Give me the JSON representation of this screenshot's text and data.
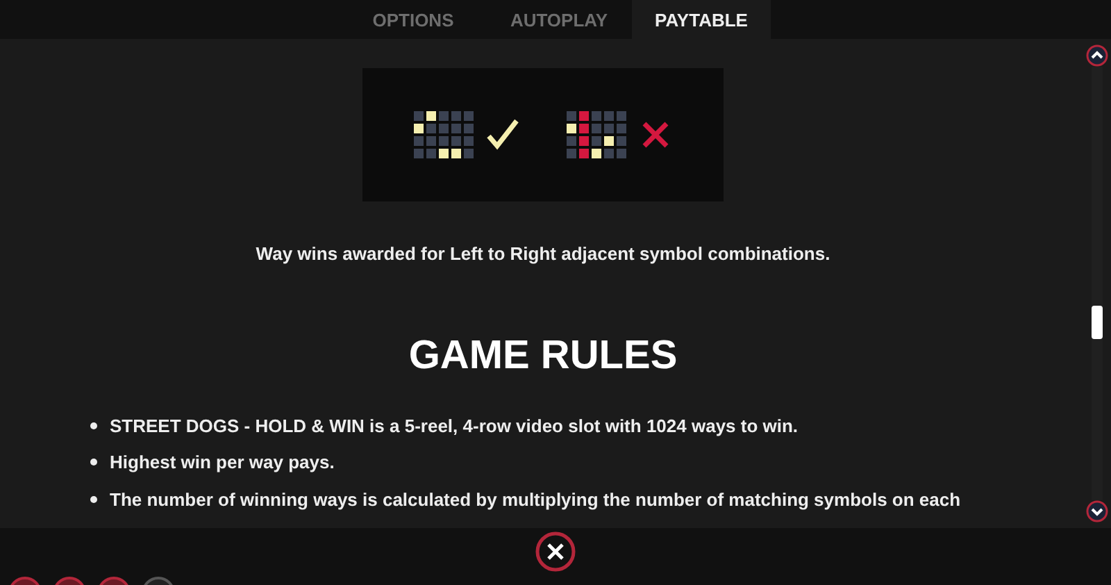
{
  "tabs": [
    {
      "label": "OPTIONS",
      "selected": false
    },
    {
      "label": "AUTOPLAY",
      "selected": false
    },
    {
      "label": "PAYTABLE",
      "selected": true
    }
  ],
  "examples": [
    {
      "valid": true,
      "rows": [
        {
          "cells": [
            {
              "color": "#3b4252"
            },
            {
              "color": "#f5efb0"
            },
            {
              "color": "#3b4252"
            },
            {
              "color": "#3b4252"
            },
            {
              "color": "#3b4252"
            }
          ]
        },
        {
          "cells": [
            {
              "color": "#f5efb0"
            },
            {
              "color": "#3b4252"
            },
            {
              "color": "#3b4252"
            },
            {
              "color": "#3b4252"
            },
            {
              "color": "#3b4252"
            }
          ]
        },
        {
          "cells": [
            {
              "color": "#3b4252"
            },
            {
              "color": "#3b4252"
            },
            {
              "color": "#3b4252"
            },
            {
              "color": "#3b4252"
            },
            {
              "color": "#3b4252"
            }
          ]
        },
        {
          "cells": [
            {
              "color": "#3b4252"
            },
            {
              "color": "#3b4252"
            },
            {
              "color": "#f5efb0"
            },
            {
              "color": "#f5efb0"
            },
            {
              "color": "#3b4252"
            }
          ]
        }
      ]
    },
    {
      "valid": false,
      "rows": [
        {
          "cells": [
            {
              "color": "#3b4252"
            },
            {
              "color": "#d4183f"
            },
            {
              "color": "#3b4252"
            },
            {
              "color": "#3b4252"
            },
            {
              "color": "#3b4252"
            }
          ]
        },
        {
          "cells": [
            {
              "color": "#f5efb0"
            },
            {
              "color": "#d4183f"
            },
            {
              "color": "#3b4252"
            },
            {
              "color": "#3b4252"
            },
            {
              "color": "#3b4252"
            }
          ]
        },
        {
          "cells": [
            {
              "color": "#3b4252"
            },
            {
              "color": "#d4183f"
            },
            {
              "color": "#3b4252"
            },
            {
              "color": "#f5efb0"
            },
            {
              "color": "#3b4252"
            }
          ]
        },
        {
          "cells": [
            {
              "color": "#3b4252"
            },
            {
              "color": "#d4183f"
            },
            {
              "color": "#f5efb0"
            },
            {
              "color": "#3b4252"
            },
            {
              "color": "#3b4252"
            }
          ]
        }
      ]
    }
  ],
  "caption": "Way wins awarded for Left to Right adjacent symbol combinations.",
  "heading": "GAME RULES",
  "rules": [
    "STREET DOGS - HOLD & WIN is a 5-reel, 4-row video slot with 1024 ways to win.",
    "Highest win per way pays.",
    "The number of winning ways is calculated by multiplying the number of matching symbols on each"
  ],
  "dock_buttons": [
    {
      "kind": "red"
    },
    {
      "kind": "red"
    },
    {
      "kind": "red"
    },
    {
      "kind": "grey"
    }
  ]
}
